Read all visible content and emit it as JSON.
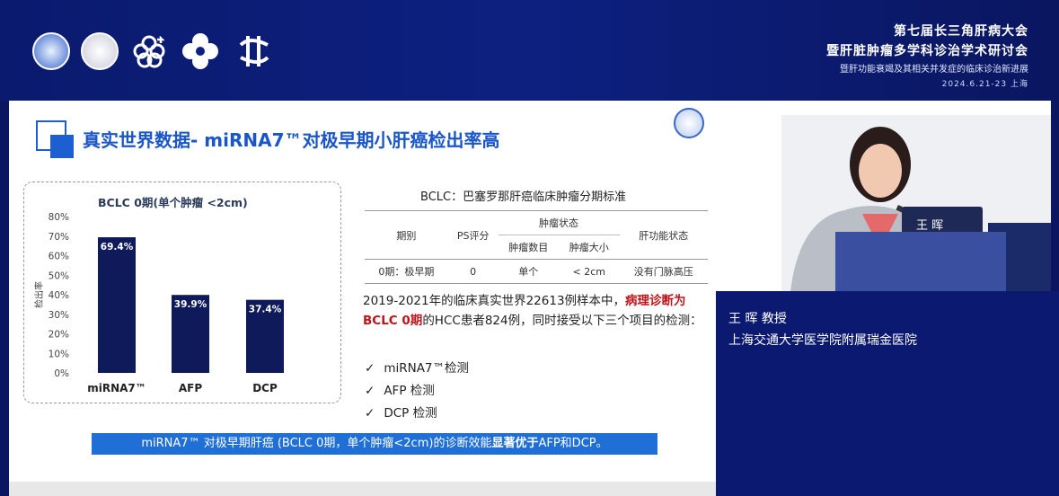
{
  "conference": {
    "line1": "第七届长三角肝病大会",
    "line2": "暨肝脏肿瘤多学科诊治学术研讨会",
    "line3": "暨肝功能衰竭及其相关并发症的临床诊治新进展",
    "date_place": "2024.6.21-23 上海"
  },
  "slide": {
    "title": "真实世界数据- miRNA7™对极早期小肝癌检出率高",
    "chart_title": "BCLC 0期(单个肿瘤 <2cm)",
    "standard_title": "BCLC：巴塞罗那肝癌临床肿瘤分期标准",
    "table": {
      "h_stage": "期别",
      "h_ps": "PS评分",
      "h_tumor": "肿瘤状态",
      "h_liver": "肝功能状态",
      "h_count": "肿瘤数目",
      "h_size": "肿瘤大小",
      "row_stage": "0期：极早期",
      "row_ps": "0",
      "row_count": "单个",
      "row_size": "< 2cm",
      "row_liver": "没有门脉高压"
    },
    "body_a": "2019-2021年的临床真实世界22613例样本中，",
    "body_red": "病理诊断为BCLC 0期",
    "body_b": "的HCC患者824例，同时接受以下三个项目的检测：",
    "checks": [
      "miRNA7™检测",
      "AFP 检测",
      "DCP 检测"
    ],
    "check_mark": "✓",
    "conclusion_a": "miRNA7™ 对极早期肝癌 (BCLC 0期，单个肿瘤<2cm)的诊断效能",
    "conclusion_b": "显著优于",
    "conclusion_c": "AFP和DCP。"
  },
  "chart_data": {
    "type": "bar",
    "title": "BCLC 0期(单个肿瘤 <2cm)",
    "ylabel": "检出率",
    "categories": [
      "miRNA7™",
      "AFP",
      "DCP"
    ],
    "values": [
      69.4,
      39.9,
      37.4
    ],
    "value_labels": [
      "69.4%",
      "39.9%",
      "37.4%"
    ],
    "ylim": [
      0,
      80
    ],
    "yticks": [
      "0%",
      "10%",
      "20%",
      "30%",
      "40%",
      "50%",
      "60%",
      "70%",
      "80%"
    ],
    "bar_color": "#0f1a5a",
    "grid": false
  },
  "speaker": {
    "name": "王  晖 教授",
    "hospital": "上海交通大学医学院附属瑞金医院",
    "nameplate": "王 晖"
  }
}
